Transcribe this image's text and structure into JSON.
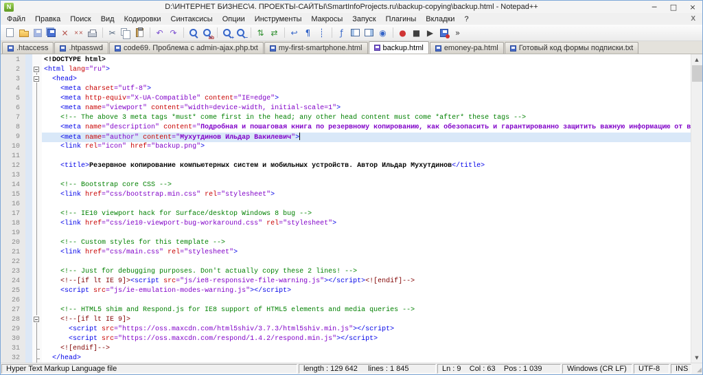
{
  "window": {
    "title": "D:\\ИНТЕРНЕТ БИЗНЕС\\4. ПРОЕКТЫ-САЙТЫ\\SmartInfoProjects.ru\\backup-copying\\backup.html - Notepad++",
    "app_icon_letter": "N",
    "controls": {
      "minimize": "─",
      "maximize": "□",
      "close": "×"
    }
  },
  "menu": {
    "items": [
      "Файл",
      "Правка",
      "Поиск",
      "Вид",
      "Кодировки",
      "Синтаксисы",
      "Опции",
      "Инструменты",
      "Макросы",
      "Запуск",
      "Плагины",
      "Вкладки",
      "?"
    ],
    "close_label": "X"
  },
  "toolbar": {
    "groups": [
      [
        {
          "name": "new-file",
          "k": "page"
        },
        {
          "name": "open-file",
          "k": "folder"
        },
        {
          "name": "save-file",
          "k": "floppy",
          "disabled": true
        },
        {
          "name": "save-all",
          "k": "floppy2"
        },
        {
          "name": "close-file",
          "g": "×",
          "c": "#b04840"
        },
        {
          "name": "close-all",
          "g": "××",
          "c": "#b04840"
        },
        {
          "name": "print",
          "k": "printer"
        }
      ],
      [
        {
          "name": "cut",
          "g": "✂",
          "c": "#55687f"
        },
        {
          "name": "copy",
          "k": "copy"
        },
        {
          "name": "paste",
          "k": "paste"
        }
      ],
      [
        {
          "name": "undo",
          "g": "↶",
          "c": "#7b4fd0"
        },
        {
          "name": "redo",
          "g": "↷",
          "c": "#7b4fd0"
        }
      ],
      [
        {
          "name": "find",
          "k": "mag"
        },
        {
          "name": "replace",
          "k": "mag",
          "sub": "ab"
        }
      ],
      [
        {
          "name": "zoom-in",
          "k": "mag",
          "sub": "+"
        },
        {
          "name": "zoom-out",
          "k": "mag",
          "sub": "−"
        }
      ],
      [
        {
          "name": "sync-scroll-vertical",
          "g": "⇅",
          "c": "#2f8f2f"
        },
        {
          "name": "sync-scroll-horizontal",
          "g": "⇄",
          "c": "#2f8f2f"
        }
      ],
      [
        {
          "name": "word-wrap",
          "g": "↩",
          "c": "#3565c8"
        },
        {
          "name": "show-all-characters",
          "g": "¶",
          "c": "#3565c8"
        },
        {
          "name": "indent-guide",
          "g": "┊",
          "c": "#3565c8"
        }
      ],
      [
        {
          "name": "function-list",
          "g": "ƒ",
          "c": "#3565c8"
        },
        {
          "name": "document-map",
          "k": "frame"
        },
        {
          "name": "document-switcher",
          "k": "frame2"
        },
        {
          "name": "file-monitoring",
          "g": "◉",
          "c": "#3565c8"
        }
      ],
      [
        {
          "name": "record-macro",
          "g": "●",
          "c": "#cf3535"
        },
        {
          "name": "stop-recording",
          "g": "■",
          "c": "#3f3f3f"
        },
        {
          "name": "play-macro",
          "g": "▶",
          "c": "#3f3f3f"
        },
        {
          "name": "save-macro",
          "k": "floppydot"
        },
        {
          "name": "run-macro-multiple",
          "g": "»",
          "c": "#3f3f3f"
        }
      ]
    ]
  },
  "tabs": {
    "active_index": 4,
    "items": [
      {
        "label": ".htaccess"
      },
      {
        "label": ".htpasswd"
      },
      {
        "label": "code69. Проблема с admin-ajax.php.txt"
      },
      {
        "label": "my-first-smartphone.html"
      },
      {
        "label": "backup.html"
      },
      {
        "label": "emoney-pa.html"
      },
      {
        "label": "Готовый код формы подписки.txt"
      }
    ]
  },
  "editor": {
    "syntax_colors": {
      "d": "#000000",
      "g": "#0000e8",
      "a": "#c80000",
      "v": "#8000c8",
      "c": "#008000",
      "m": "#800000",
      "x": "#000000"
    },
    "current_line_highlight": "#d9e8f8",
    "lines": [
      {
        "n": 1,
        "f": "",
        "s": [
          [
            "d",
            "<!DOCTYPE html>"
          ]
        ]
      },
      {
        "n": 2,
        "f": "box",
        "s": [
          [
            "g",
            "<html "
          ],
          [
            "a",
            "lang"
          ],
          [
            "v",
            "=\"ru\""
          ],
          [
            "g",
            ">"
          ]
        ]
      },
      {
        "n": 3,
        "f": "box",
        "s": [
          [
            "x",
            "  "
          ],
          [
            "g",
            "<head>"
          ]
        ]
      },
      {
        "n": 4,
        "f": "line",
        "s": [
          [
            "x",
            "    "
          ],
          [
            "g",
            "<meta "
          ],
          [
            "a",
            "charset"
          ],
          [
            "v",
            "=\"utf-8\""
          ],
          [
            "g",
            ">"
          ]
        ]
      },
      {
        "n": 5,
        "f": "line",
        "s": [
          [
            "x",
            "    "
          ],
          [
            "g",
            "<meta "
          ],
          [
            "a",
            "http-equiv"
          ],
          [
            "v",
            "=\"X-UA-Compatible\" "
          ],
          [
            "a",
            "content"
          ],
          [
            "v",
            "=\"IE=edge\""
          ],
          [
            "g",
            ">"
          ]
        ]
      },
      {
        "n": 6,
        "f": "line",
        "s": [
          [
            "x",
            "    "
          ],
          [
            "g",
            "<meta "
          ],
          [
            "a",
            "name"
          ],
          [
            "v",
            "=\"viewport\" "
          ],
          [
            "a",
            "content"
          ],
          [
            "v",
            "=\"width=device-width, initial-scale=1\""
          ],
          [
            "g",
            ">"
          ]
        ]
      },
      {
        "n": 7,
        "f": "line",
        "s": [
          [
            "x",
            "    "
          ],
          [
            "c",
            "<!-- The above 3 meta tags *must* come first in the head; any other head content must come *after* these tags -->"
          ]
        ]
      },
      {
        "n": 8,
        "f": "line",
        "s": [
          [
            "x",
            "    "
          ],
          [
            "g",
            "<meta "
          ],
          [
            "a",
            "name"
          ],
          [
            "v",
            "=\"description\" "
          ],
          [
            "a",
            "content"
          ],
          [
            "v",
            "=\""
          ],
          [
            "v",
            "Подробная и пошаговая книга по резервному копированию, как обезопасить и гарантированно защитить важную информацию от внезапной потери данных",
            1
          ]
        ]
      },
      {
        "n": 9,
        "f": "line",
        "hl": 1,
        "caret": 1,
        "s": [
          [
            "x",
            "    "
          ],
          [
            "g",
            "<meta "
          ],
          [
            "a",
            "name"
          ],
          [
            "v",
            "=\"author\" "
          ],
          [
            "a",
            "content"
          ],
          [
            "v",
            "=\""
          ],
          [
            "v",
            "Мухутдинов Ильдар Вакилевич",
            1
          ],
          [
            "v",
            "\""
          ],
          [
            "g",
            ">"
          ]
        ]
      },
      {
        "n": 10,
        "f": "line",
        "s": [
          [
            "x",
            "    "
          ],
          [
            "g",
            "<link "
          ],
          [
            "a",
            "rel"
          ],
          [
            "v",
            "=\"icon\" "
          ],
          [
            "a",
            "href"
          ],
          [
            "v",
            "=\"backup.png\""
          ],
          [
            "g",
            ">"
          ]
        ]
      },
      {
        "n": 11,
        "f": "line",
        "s": []
      },
      {
        "n": 12,
        "f": "line",
        "s": [
          [
            "x",
            "    "
          ],
          [
            "g",
            "<title>"
          ],
          [
            "x",
            "Резервное копирование компьютерных систем и мобильных устройств. Автор Ильдар Мухутдинов",
            1
          ],
          [
            "g",
            "</title>"
          ]
        ]
      },
      {
        "n": 13,
        "f": "line",
        "s": []
      },
      {
        "n": 14,
        "f": "line",
        "s": [
          [
            "x",
            "    "
          ],
          [
            "c",
            "<!-- Bootstrap core CSS -->"
          ]
        ]
      },
      {
        "n": 15,
        "f": "line",
        "s": [
          [
            "x",
            "    "
          ],
          [
            "g",
            "<link "
          ],
          [
            "a",
            "href"
          ],
          [
            "v",
            "=\"css/bootstrap.min.css\" "
          ],
          [
            "a",
            "rel"
          ],
          [
            "v",
            "=\"stylesheet\""
          ],
          [
            "g",
            ">"
          ]
        ]
      },
      {
        "n": 16,
        "f": "line",
        "s": []
      },
      {
        "n": 17,
        "f": "line",
        "s": [
          [
            "x",
            "    "
          ],
          [
            "c",
            "<!-- IE10 viewport hack for Surface/desktop Windows 8 bug -->"
          ]
        ]
      },
      {
        "n": 18,
        "f": "line",
        "s": [
          [
            "x",
            "    "
          ],
          [
            "g",
            "<link "
          ],
          [
            "a",
            "href"
          ],
          [
            "v",
            "=\"css/ie10-viewport-bug-workaround.css\" "
          ],
          [
            "a",
            "rel"
          ],
          [
            "v",
            "=\"stylesheet\""
          ],
          [
            "g",
            ">"
          ]
        ]
      },
      {
        "n": 19,
        "f": "line",
        "s": []
      },
      {
        "n": 20,
        "f": "line",
        "s": [
          [
            "x",
            "    "
          ],
          [
            "c",
            "<!-- Custom styles for this template -->"
          ]
        ]
      },
      {
        "n": 21,
        "f": "line",
        "s": [
          [
            "x",
            "    "
          ],
          [
            "g",
            "<link "
          ],
          [
            "a",
            "href"
          ],
          [
            "v",
            "=\"css/main.css\" "
          ],
          [
            "a",
            "rel"
          ],
          [
            "v",
            "=\"stylesheet\""
          ],
          [
            "g",
            ">"
          ]
        ]
      },
      {
        "n": 22,
        "f": "line",
        "s": []
      },
      {
        "n": 23,
        "f": "line",
        "s": [
          [
            "x",
            "    "
          ],
          [
            "c",
            "<!-- Just for debugging purposes. Don't actually copy these 2 lines! -->"
          ]
        ]
      },
      {
        "n": 24,
        "f": "line",
        "s": [
          [
            "x",
            "    "
          ],
          [
            "m",
            "<!--[if lt IE 9]>"
          ],
          [
            "g",
            "<script "
          ],
          [
            "a",
            "src"
          ],
          [
            "v",
            "=\"js/ie8-responsive-file-warning.js\""
          ],
          [
            "g",
            "></script>"
          ],
          [
            "m",
            "<![endif]-->"
          ]
        ]
      },
      {
        "n": 25,
        "f": "line",
        "s": [
          [
            "x",
            "    "
          ],
          [
            "g",
            "<script "
          ],
          [
            "a",
            "src"
          ],
          [
            "v",
            "=\"js/ie-emulation-modes-warning.js\""
          ],
          [
            "g",
            "></script>"
          ]
        ]
      },
      {
        "n": 26,
        "f": "line",
        "s": []
      },
      {
        "n": 27,
        "f": "line",
        "s": [
          [
            "x",
            "    "
          ],
          [
            "c",
            "<!-- HTML5 shim and Respond.js for IE8 support of HTML5 elements and media queries -->"
          ]
        ]
      },
      {
        "n": 28,
        "f": "box",
        "s": [
          [
            "x",
            "    "
          ],
          [
            "m",
            "<!--[if lt IE 9]>"
          ]
        ]
      },
      {
        "n": 29,
        "f": "line",
        "s": [
          [
            "x",
            "      "
          ],
          [
            "g",
            "<script "
          ],
          [
            "a",
            "src"
          ],
          [
            "v",
            "=\"https://oss.maxcdn.com/html5shiv/3.7.3/html5shiv.min.js\""
          ],
          [
            "g",
            "></script>"
          ]
        ]
      },
      {
        "n": 30,
        "f": "line",
        "s": [
          [
            "x",
            "      "
          ],
          [
            "g",
            "<script "
          ],
          [
            "a",
            "src"
          ],
          [
            "v",
            "=\"https://oss.maxcdn.com/respond/1.4.2/respond.min.js\""
          ],
          [
            "g",
            "></script>"
          ]
        ]
      },
      {
        "n": 31,
        "f": "tee",
        "s": [
          [
            "x",
            "    "
          ],
          [
            "m",
            "<![endif]-->"
          ]
        ]
      },
      {
        "n": 32,
        "f": "tee",
        "s": [
          [
            "x",
            "  "
          ],
          [
            "g",
            "</head>"
          ]
        ]
      }
    ]
  },
  "status": {
    "file_type": "Hyper Text Markup Language file",
    "length_lines": "length : 129 642     lines : 1 845",
    "cursor": "Ln : 9    Col : 63    Pos : 1 039",
    "eol": "Windows (CR LF)",
    "encoding": "UTF-8",
    "insert_mode": "INS",
    "grip": "◢"
  }
}
